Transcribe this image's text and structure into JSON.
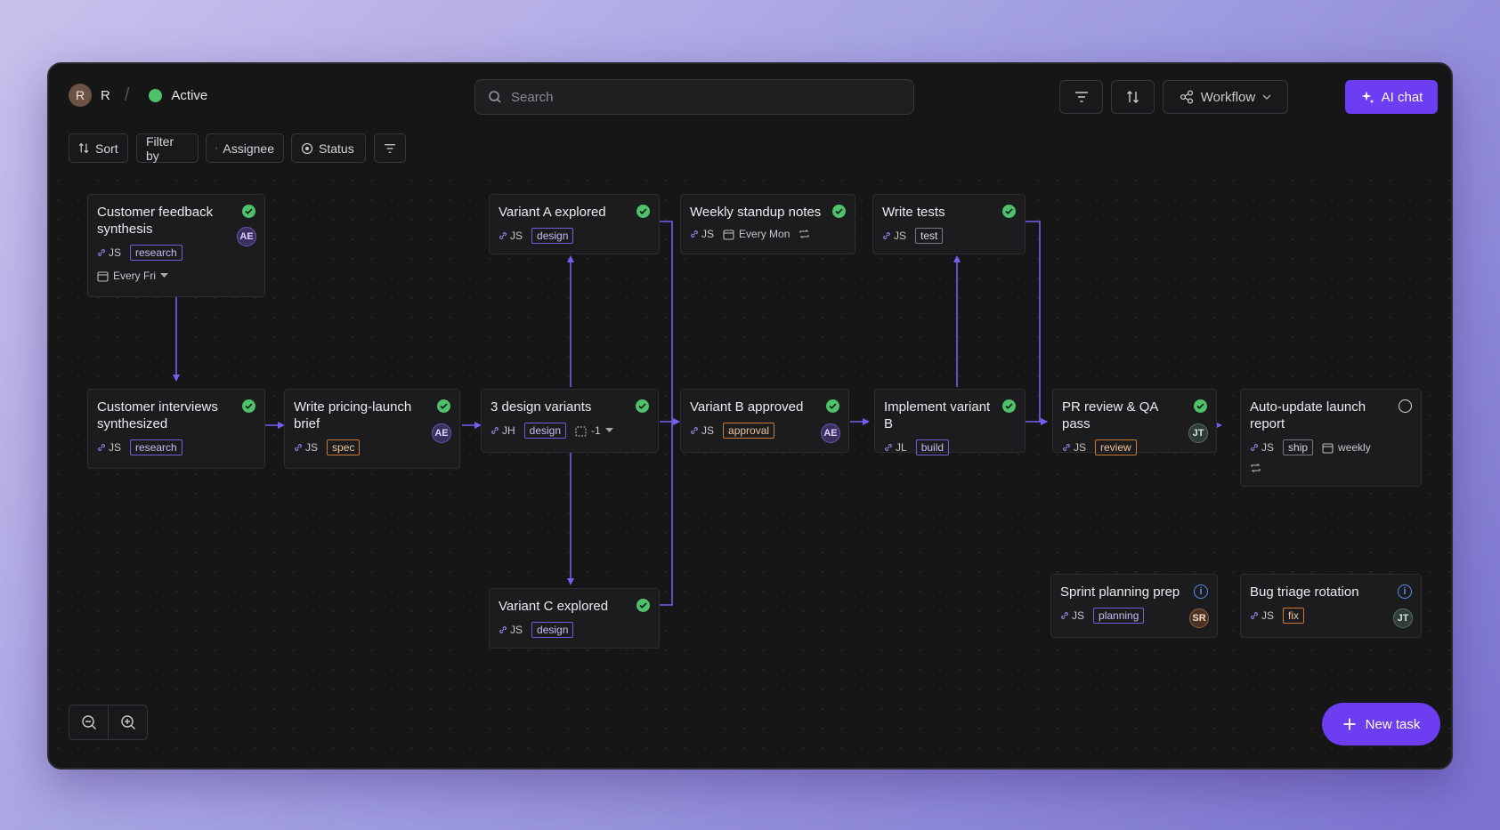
{
  "header": {
    "workspace_initial": "R",
    "workspace_name": "R",
    "status": "Active",
    "search_placeholder": "Search",
    "workflow_label": "Workflow",
    "ai_chat_label": "AI chat"
  },
  "toolbar": {
    "sort": "Sort",
    "filter_by": "Filter by",
    "assignee": "Assignee",
    "status": "Status"
  },
  "cards": {
    "c1": {
      "title": "Customer feedback synthesis",
      "who": "JS",
      "tag": "research",
      "avatar": "AE",
      "repeat": "Every Fri"
    },
    "c2": {
      "title": "Customer interviews synthesized",
      "who": "JS",
      "tag": "research"
    },
    "c3": {
      "title": "Write pricing-launch brief",
      "who": "JS",
      "tag": "spec",
      "avatar": "AE"
    },
    "c4": {
      "title": "3 design variants",
      "who": "JH",
      "tag": "design",
      "sub": "-1"
    },
    "c5": {
      "title": "Variant A explored",
      "who": "JS",
      "tag": "design"
    },
    "c6": {
      "title": "Variant C explored",
      "who": "JS",
      "tag": "design"
    },
    "c7": {
      "title": "Weekly standup notes",
      "who": "JS",
      "repeat": "Every Mon"
    },
    "c8": {
      "title": "Variant B approved",
      "who": "JS",
      "tag": "approval",
      "avatar": "AE"
    },
    "c9": {
      "title": "Write tests",
      "who": "JS",
      "tag": "test"
    },
    "c10": {
      "title": "Implement variant B",
      "who": "JL",
      "tag": "build"
    },
    "c11": {
      "title": "PR review & QA pass",
      "who": "JS",
      "tag": "review",
      "avatar": "JT"
    },
    "c12": {
      "title": "Auto-update launch report",
      "who": "JS",
      "tag": "ship",
      "repeat": "weekly"
    },
    "c13": {
      "title": "Sprint planning prep",
      "who": "JS",
      "tag": "planning",
      "avatar": "SR"
    },
    "c14": {
      "title": "Bug triage rotation",
      "who": "JS",
      "tag": "fix",
      "avatar": "JT"
    }
  },
  "new_task_label": "New task",
  "colors": {
    "accent": "#6d3df2",
    "done": "#4fc16a",
    "link": "#7b5cf0",
    "info": "#5b8def"
  }
}
